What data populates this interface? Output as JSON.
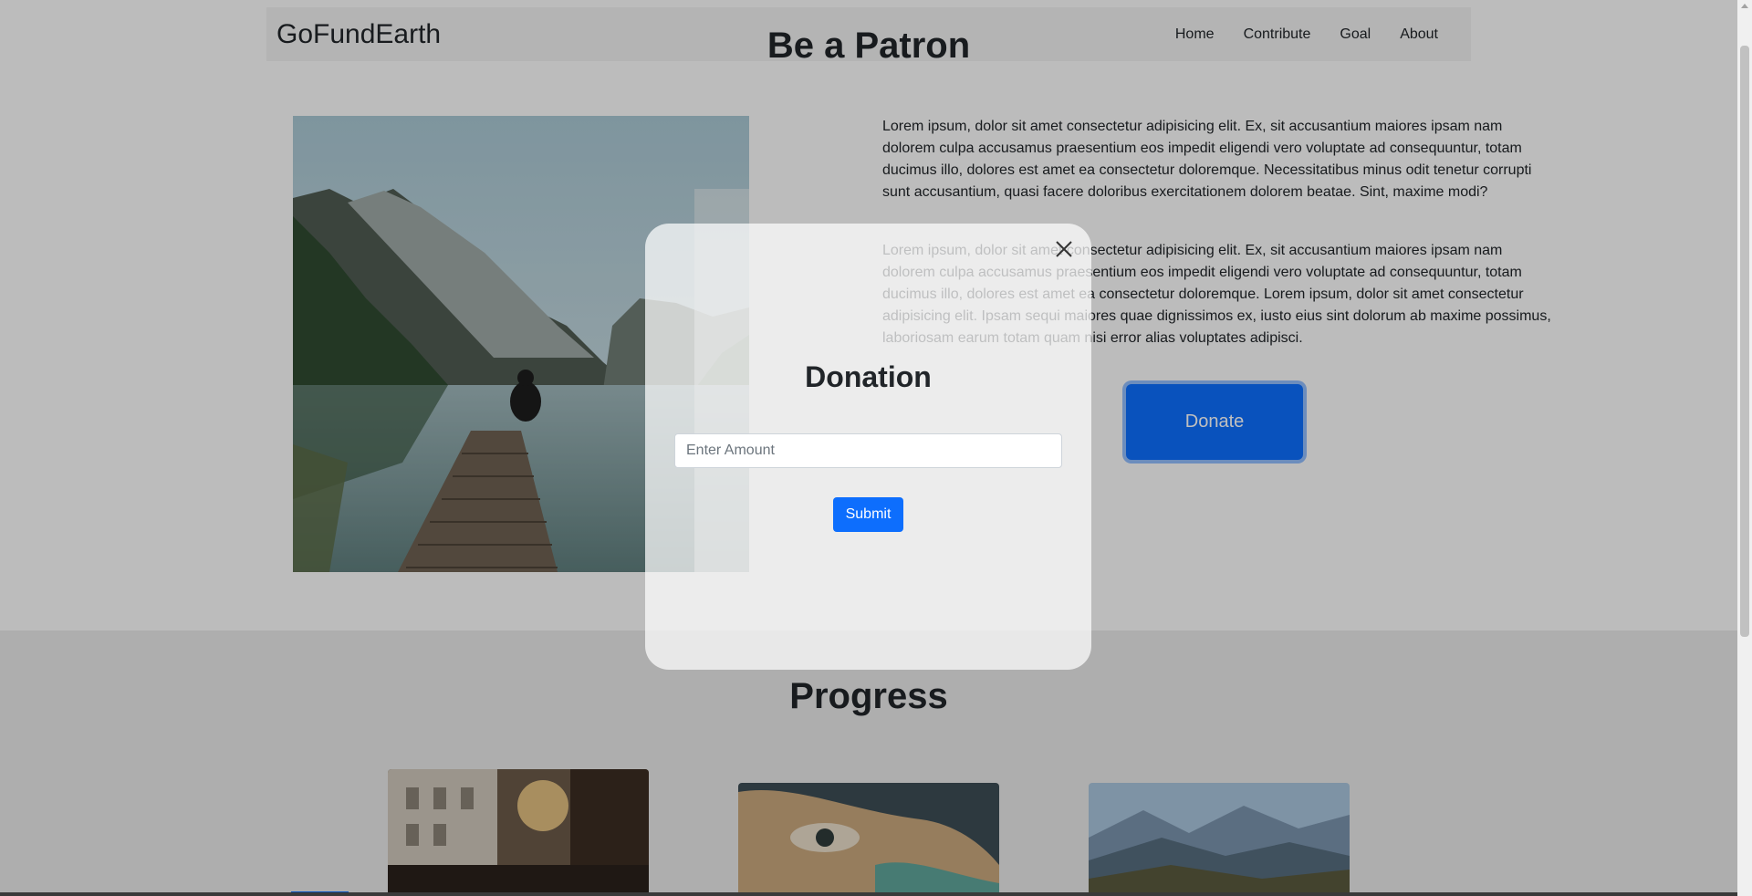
{
  "navbar": {
    "brand": "GoFundEarth",
    "links": [
      "Home",
      "Contribute",
      "Goal",
      "About"
    ]
  },
  "patron": {
    "title": "Be a Patron",
    "paragraph_1": "Lorem ipsum, dolor sit amet consectetur adipisicing elit. Ex, sit accusantium maiores ipsam nam dolorem culpa accusamus praesentium eos impedit eligendi vero voluptate ad consequuntur, totam ducimus illo, dolores est amet ea consectetur doloremque. Necessitatibus minus odit tenetur corrupti sunt accusantium, quasi facere doloribus exercitationem dolorem beatae. Sint, maxime modi?",
    "paragraph_2": "Lorem ipsum, dolor sit amet consectetur adipisicing elit. Ex, sit accusantium maiores ipsam nam dolorem culpa accusamus praesentium eos impedit eligendi vero voluptate ad consequuntur, totam ducimus illo, dolores est amet ea consectetur doloremque. Lorem ipsum, dolor sit amet consectetur adipisicing elit. Ipsam sequi maiores quae dignissimos ex, iusto eius sint dolorum ab maxime possimus, laboriosam earum totam quam nisi error alias voluptates adipisci.",
    "donate_label": "Donate"
  },
  "progress": {
    "title": "Progress"
  },
  "modal": {
    "title": "Donation",
    "amount_placeholder": "Enter Amount",
    "submit_label": "Submit"
  },
  "colors": {
    "primary": "#0d6efd",
    "overlay": "rgba(0,0,0,0.25)"
  }
}
